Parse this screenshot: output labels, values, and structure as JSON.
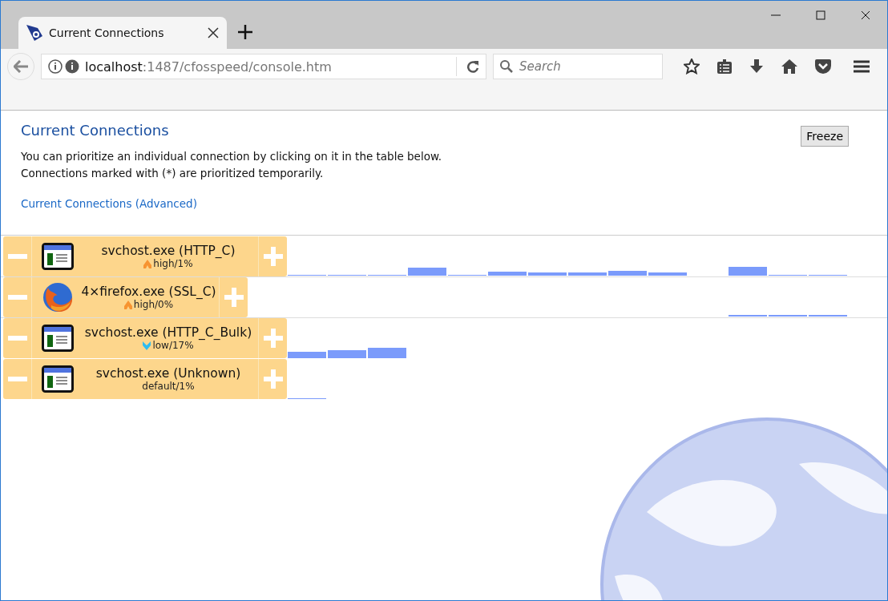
{
  "browser": {
    "tab_title": "Current Connections",
    "url_host": "localhost",
    "url_path": ":1487/cfosspeed/console.htm",
    "search": {
      "placeholder": "Search"
    }
  },
  "page": {
    "title": "Current Connections",
    "freeze_button": "Freeze",
    "intro": [
      "You can prioritize an individual connection by clicking on it in the table below.",
      "Connections marked with (*) are prioritized temporarily."
    ],
    "advanced_link": "Current Connections (Advanced)"
  },
  "connections": [
    {
      "name": "svchost.exe (HTTP_C)",
      "kind": "window",
      "priority": "high",
      "share": "/1%",
      "wide": true
    },
    {
      "name": "4×firefox.exe (SSL_C)",
      "kind": "firefox",
      "priority": "high",
      "share": "/0%",
      "wide": false
    },
    {
      "name": "svchost.exe (HTTP_C_Bulk)",
      "kind": "window",
      "priority": "low",
      "share": "/17%",
      "wide": true
    },
    {
      "name": "svchost.exe (Unknown)",
      "kind": "window",
      "priority": "default",
      "share": "/1%",
      "wide": true
    }
  ]
}
